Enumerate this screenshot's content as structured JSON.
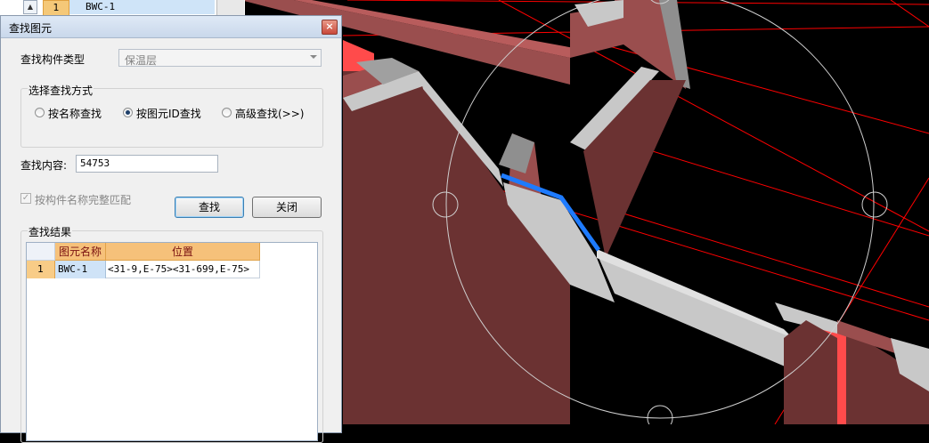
{
  "background_list": {
    "row_number": "1",
    "row_name": "BWC-1"
  },
  "dialog": {
    "title": "查找图元",
    "close_icon": "close-icon",
    "component_type_label": "查找构件类型",
    "component_type_value": "保温层",
    "search_mode_group_label": "选择查找方式",
    "radio_by_name": "按名称查找",
    "radio_by_id": "按图元ID查找",
    "radio_advanced": "高级查找(>>)",
    "selected_mode": "按图元ID查找",
    "content_label": "查找内容:",
    "content_value": "54753",
    "exact_match_label": "按构件名称完整匹配",
    "exact_match_checked": true,
    "find_button": "查找",
    "close_button": "关闭",
    "results_group_label": "查找结果",
    "results": {
      "columns": [
        "图元名称",
        "位置"
      ],
      "rows": [
        {
          "num": "1",
          "name": "BWC-1",
          "position": "<31-9,E-75><31-699,E-75>"
        }
      ]
    }
  },
  "viewport": {
    "colors": {
      "background": "#000000",
      "wall_dark": "#6b3232",
      "wall_top": "#9a4e4e",
      "slab_gray": "#c8c8c8",
      "red_strip": "#ff4b4b",
      "axis_line": "#ff0000",
      "selection": "#1e7bff"
    }
  }
}
